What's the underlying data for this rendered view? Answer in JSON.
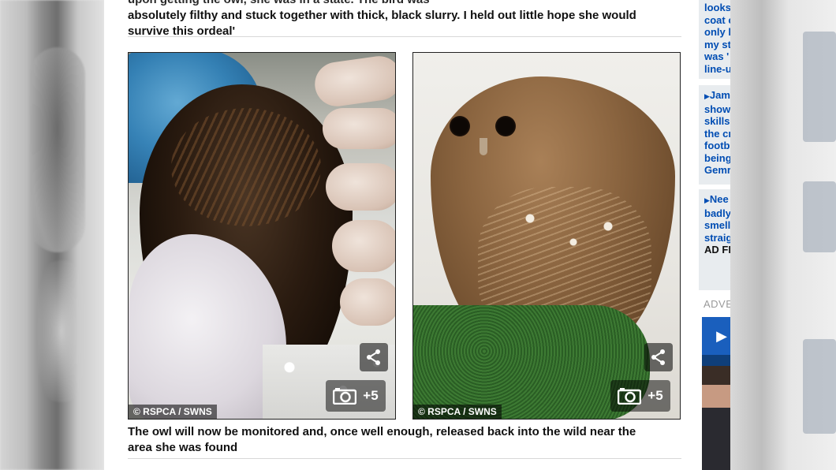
{
  "article": {
    "quote_partial": "upon getting the owl, she was in a state. The bird was",
    "quote_line1": "absolutely filthy and stuck together with thick, black slurry. I held out little hope she would",
    "quote_line2": "survive this ordeal'",
    "caption_line1": "The owl will now be monitored and, once well enough, released back into the wild near the",
    "caption_line2": "area she was found"
  },
  "photos": [
    {
      "credit": "© RSPCA / SWNS",
      "gallery_count": "+5",
      "share_icon": "share-icon",
      "camera_icon": "camera-icon"
    },
    {
      "credit": "© RSPCA / SWNS",
      "gallery_count": "+5",
      "share_icon": "share-icon",
      "camera_icon": "camera-icon"
    }
  ],
  "sidebar": {
    "card1": [
      "looks",
      "coat c",
      "only l",
      "my st",
      "was '",
      "line-u"
    ],
    "card2": [
      "Jam",
      "show",
      "skills",
      "the cr",
      "footb",
      "being",
      "Gemr"
    ],
    "card3": [
      "Nee",
      "badly",
      "smell",
      "straig"
    ],
    "card3_tag": "AD FI",
    "adv_label": "ADVE"
  },
  "colors": {
    "link_blue": "#004db3",
    "sidebar_card_bg": "#e8ecef",
    "credit_overlay": "rgba(0,0,0,0.55)"
  }
}
